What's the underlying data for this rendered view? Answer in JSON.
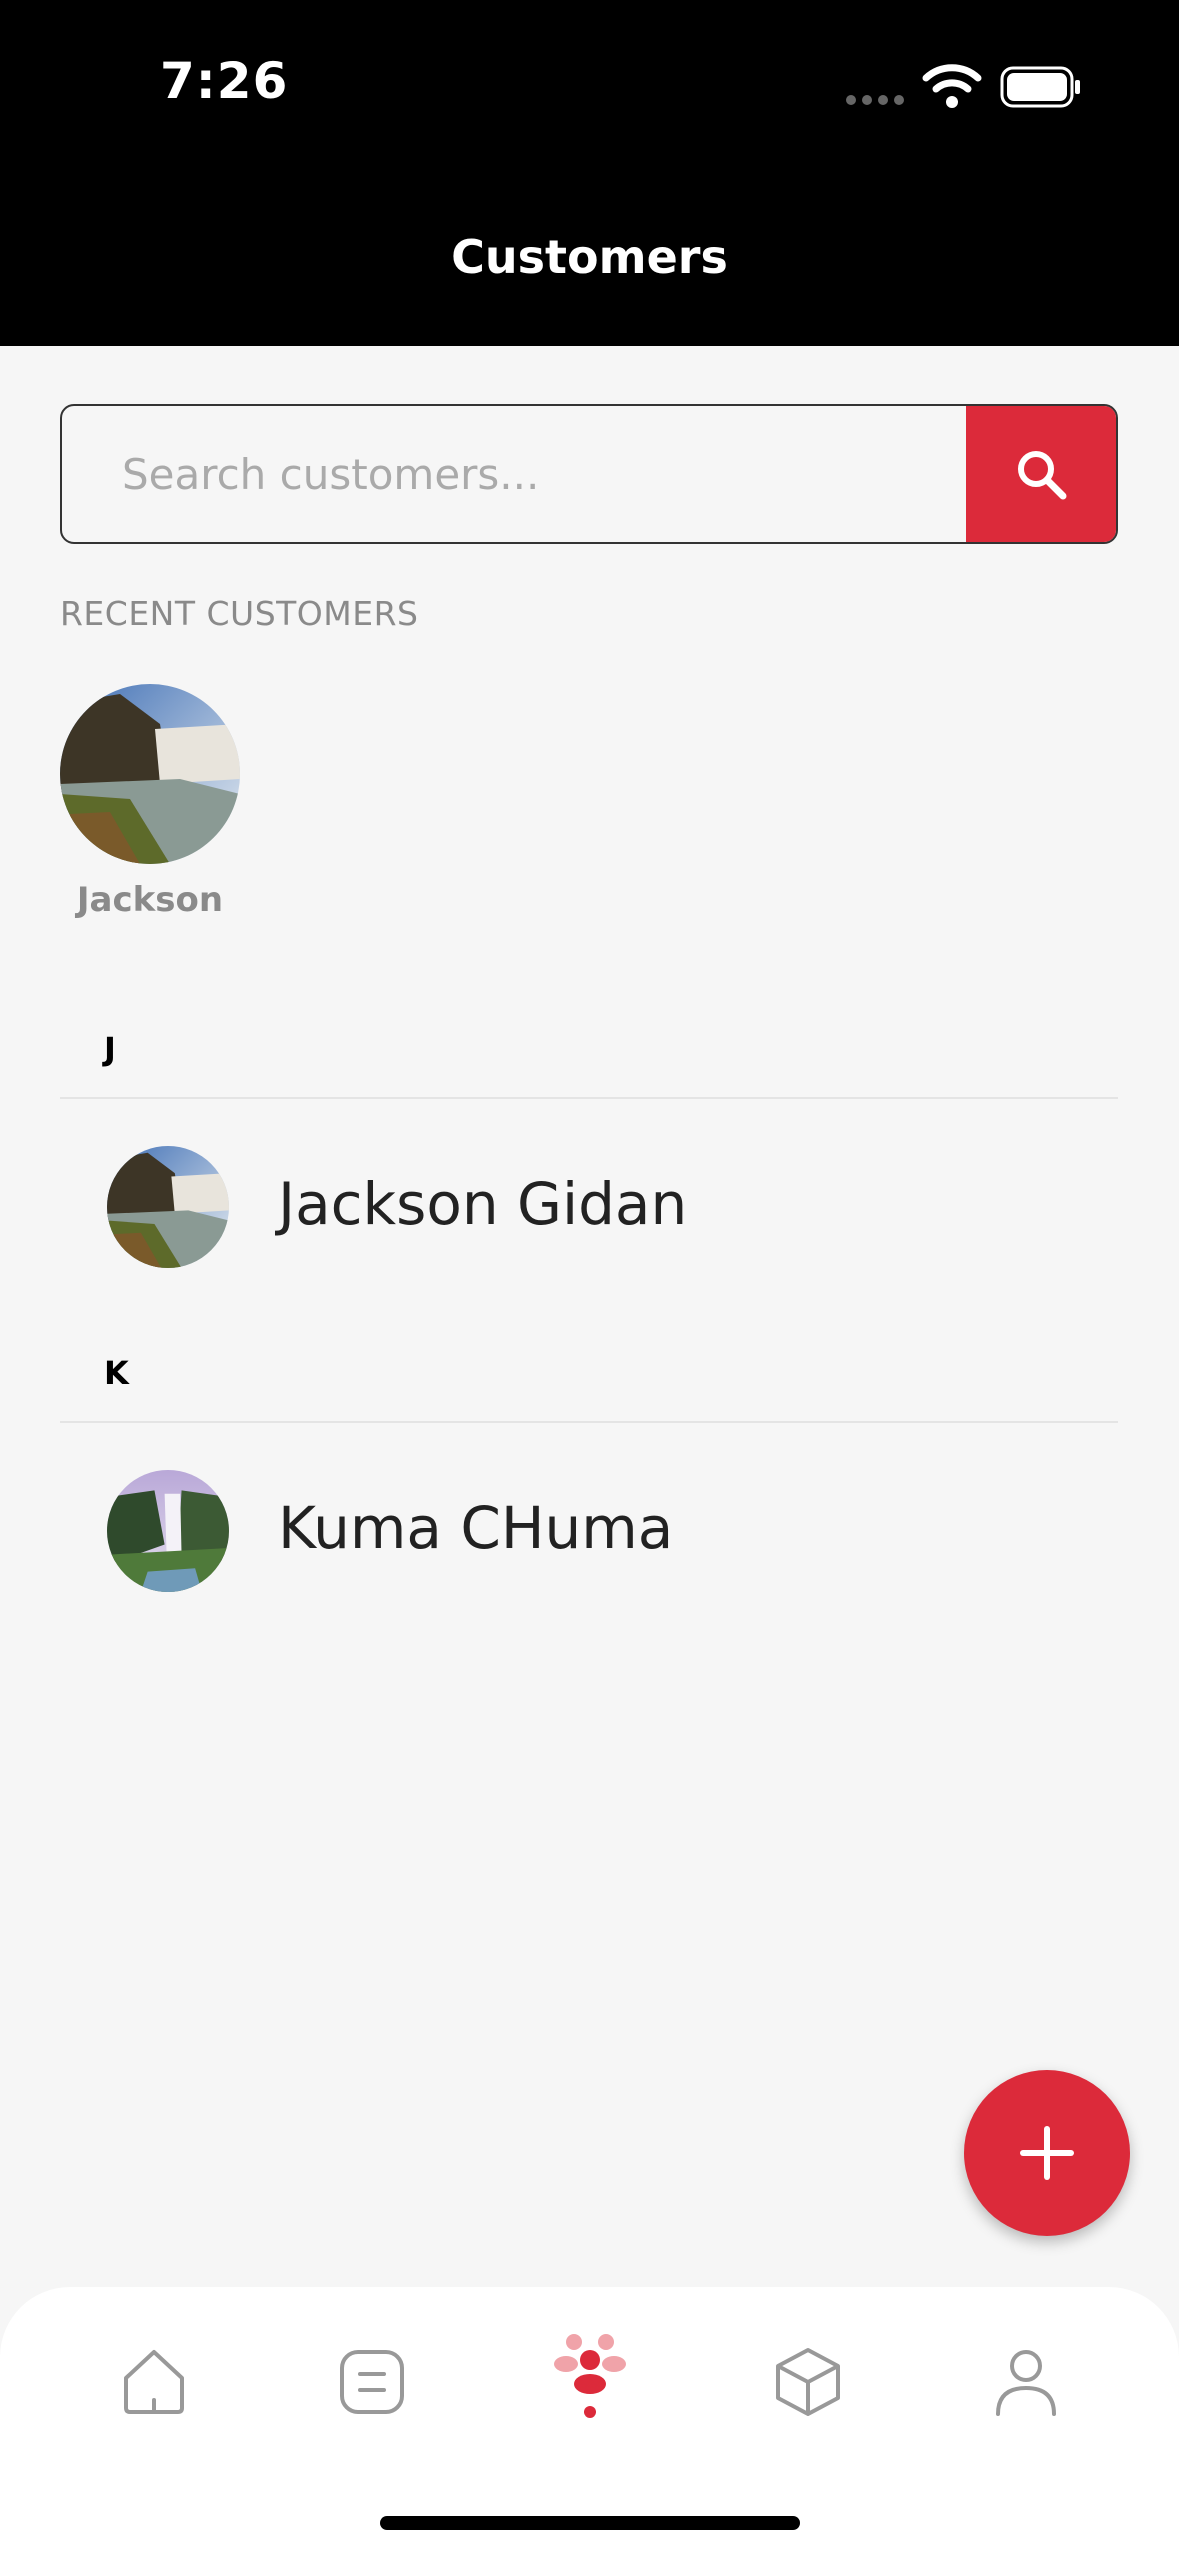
{
  "status_bar": {
    "time": "7:26"
  },
  "header": {
    "title": "Customers"
  },
  "search": {
    "placeholder": "Search customers..."
  },
  "recent": {
    "label": "RECENT CUSTOMERS",
    "items": [
      {
        "name": "Jackson"
      }
    ]
  },
  "groups": [
    {
      "letter": "J",
      "customers": [
        {
          "name": "Jackson Gidan"
        }
      ]
    },
    {
      "letter": "K",
      "customers": [
        {
          "name": "Kuma CHuma"
        }
      ]
    }
  ],
  "bottom_nav": {
    "items": [
      {
        "icon": "home-icon",
        "active": false
      },
      {
        "icon": "orders-icon",
        "active": false
      },
      {
        "icon": "customers-icon",
        "active": true
      },
      {
        "icon": "products-icon",
        "active": false
      },
      {
        "icon": "profile-icon",
        "active": false
      }
    ]
  },
  "colors": {
    "accent": "#dc2a3a",
    "header_bg": "#000000",
    "background": "#f6f6f6"
  }
}
